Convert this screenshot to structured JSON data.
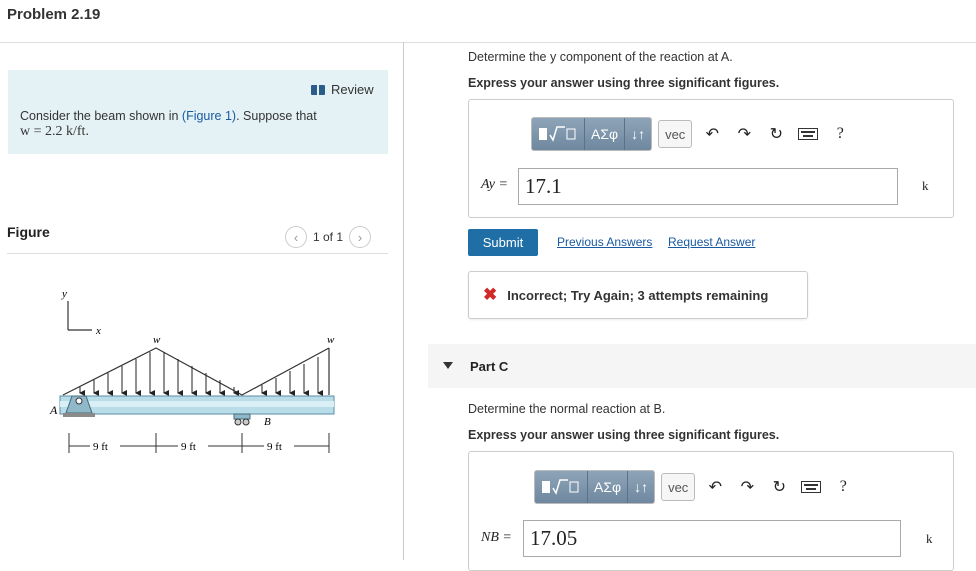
{
  "header": {
    "title": "Problem 2.19"
  },
  "left": {
    "review_label": "Review",
    "problem": {
      "intro": "Consider the beam shown in ",
      "figure_link": "(Figure 1)",
      "after_link": ". Suppose that",
      "w_expr": "w = 2.2 k/ft."
    },
    "figure": {
      "heading": "Figure",
      "pager": "1 of 1"
    },
    "diagram": {
      "labels": {
        "y": "y",
        "x": "x",
        "w1": "w",
        "w2": "w",
        "A": "A",
        "B": "B"
      },
      "dims": [
        "9 ft",
        "9 ft",
        "9 ft"
      ]
    }
  },
  "part_b": {
    "question": "Determine the y component of the reaction at A.",
    "instruction": "Express your answer using three significant figures.",
    "toolbar": {
      "greek": "ΑΣφ",
      "arrows": "↓↑",
      "vec": "vec",
      "help": "?"
    },
    "var_label": "Ay =",
    "value": "17.1",
    "unit": "k",
    "submit": "Submit",
    "previous_answers": "Previous Answers",
    "request_answer": "Request Answer",
    "feedback": "Incorrect; Try Again; 3 attempts remaining"
  },
  "part_c": {
    "label": "Part C",
    "question": "Determine the normal reaction at B.",
    "instruction": "Express your answer using three significant figures.",
    "toolbar": {
      "greek": "ΑΣφ",
      "arrows": "↓↑",
      "vec": "vec",
      "help": "?"
    },
    "var_label": "NB =",
    "value": "17.05",
    "unit": "k"
  },
  "colors": {
    "accent": "#1f6fa6",
    "review_bg": "#e5f2f5",
    "error": "#d12828",
    "beam": "#b8dce8"
  }
}
